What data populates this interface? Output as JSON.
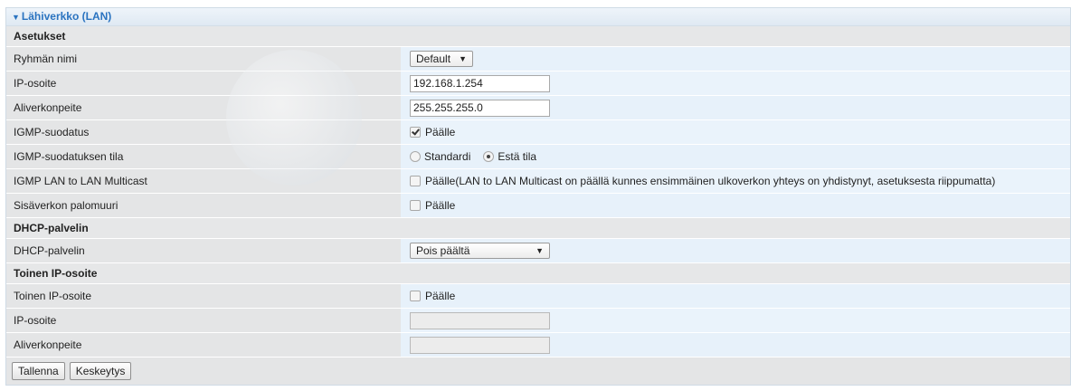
{
  "title": "Lähiverkko (LAN)",
  "sections": {
    "asetukset": "Asetukset",
    "dhcp": "DHCP-palvelin",
    "toinen": "Toinen IP-osoite"
  },
  "rows": {
    "group_name": {
      "label": "Ryhmän nimi",
      "value": "Default"
    },
    "ip": {
      "label": "IP-osoite",
      "value": "192.168.1.254"
    },
    "mask": {
      "label": "Aliverkonpeite",
      "value": "255.255.255.0"
    },
    "igmp": {
      "label": "IGMP-suodatus",
      "option": "Päälle",
      "checked": true
    },
    "igmp_mode": {
      "label": "IGMP-suodatuksen tila",
      "opt1": "Standardi",
      "opt2": "Estä tila",
      "selected": "Estä tila"
    },
    "igmp_lan": {
      "label": "IGMP LAN to LAN Multicast",
      "option": "Päälle(LAN to LAN Multicast on päällä kunnes ensimmäinen ulkoverkon yhteys on yhdistynyt, asetuksesta riippumatta)",
      "checked": false
    },
    "firewall": {
      "label": "Sisäverkon palomuuri",
      "option": "Päälle",
      "checked": false
    },
    "dhcp_server": {
      "label": "DHCP-palvelin",
      "value": "Pois päältä"
    },
    "second_ip": {
      "label": "Toinen IP-osoite",
      "option": "Päälle",
      "checked": false
    },
    "second_ip_addr": {
      "label": "IP-osoite",
      "value": ""
    },
    "second_mask": {
      "label": "Aliverkonpeite",
      "value": ""
    }
  },
  "buttons": {
    "save": "Tallenna",
    "cancel": "Keskeytys"
  }
}
